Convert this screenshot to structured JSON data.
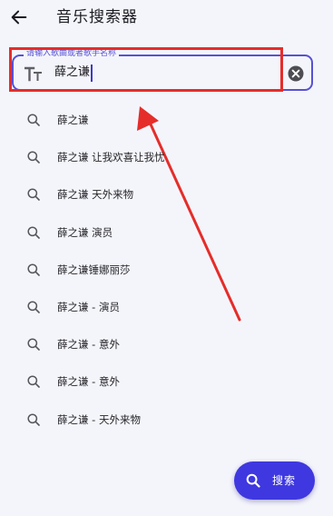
{
  "header": {
    "title": "音乐搜索器"
  },
  "search": {
    "label": "请输入歌曲或者歌手名称",
    "value": "薛之谦"
  },
  "suggestions": [
    {
      "text": "薛之谦"
    },
    {
      "text": "薛之谦 让我欢喜让我忧"
    },
    {
      "text": "薛之谦 天外来物"
    },
    {
      "text": "薛之谦 演员"
    },
    {
      "text": "薛之谦锤娜丽莎"
    },
    {
      "text": "薛之谦 - 演员"
    },
    {
      "text": "薛之谦 - 意外"
    },
    {
      "text": "薛之谦 - 意外"
    },
    {
      "text": "薛之谦 - 天外来物"
    }
  ],
  "fab": {
    "label": "搜索"
  },
  "colors": {
    "accent": "#5751d3",
    "fab": "#3f38e0",
    "annotation": "#e52d2a",
    "background": "#f4f5fb"
  },
  "icons": {
    "back": "arrow-left-icon",
    "text_format": "text-format-icon",
    "clear": "clear-circle-icon",
    "suggestion": "search-icon",
    "fab": "search-icon"
  }
}
